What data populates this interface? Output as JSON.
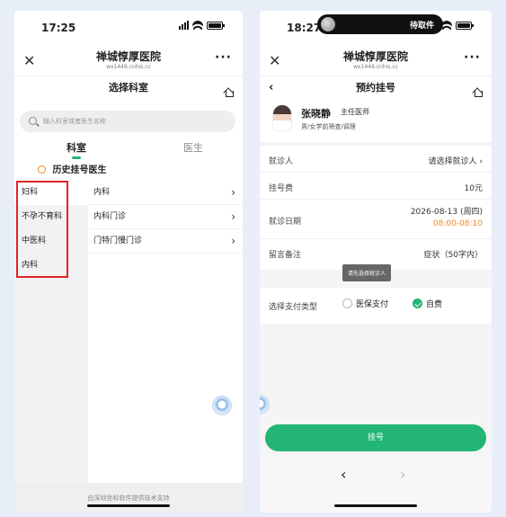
{
  "phone_left": {
    "status": {
      "time": "17:25"
    },
    "navbar": {
      "close": "✕",
      "title": "禅城惇厚医院",
      "domain": "wx1449.cnhis.cc",
      "more": "···"
    },
    "subbar": {
      "title": "选择科室"
    },
    "search": {
      "placeholder": "输入科室或者医生名称"
    },
    "tabs": {
      "dept": "科室",
      "doctor": "医生"
    },
    "history": "历史挂号医生",
    "departments": [
      "妇科",
      "不孕不育科",
      "中医科",
      "内科"
    ],
    "subdepartments": [
      "内科",
      "内科门诊",
      "门特门慢门诊"
    ],
    "chevron": "›",
    "footer": "由深圳坐标软件提供技术支持"
  },
  "phone_right": {
    "status": {
      "time": "18:27",
      "notice": "待取件"
    },
    "navbar": {
      "close": "✕",
      "title": "禅城惇厚医院",
      "domain": "wx1449.cnhis.cc",
      "more": "···"
    },
    "subbar": {
      "back": "‹",
      "title": "预约挂号"
    },
    "doctor": {
      "name": "张晓静",
      "title": "主任医师",
      "specialty": "男/女学前筛查/调理"
    },
    "form": {
      "patient_label": "就诊人",
      "patient_value": "请选择就诊人 ›",
      "fee_label": "挂号费",
      "fee_value": "10元",
      "date_label": "就诊日期",
      "date_value": "2026-08-13 (周四)",
      "time_value": "08:00-08:10",
      "remark_label": "留言备注",
      "remark_placeholder": "症状（50字内）"
    },
    "tooltip": "请先选择就诊人",
    "pay": {
      "label": "选择支付类型",
      "option1": "医保支付",
      "option2": "自费"
    },
    "button": "挂号",
    "bottom": {
      "back": "‹",
      "forward": "›"
    }
  },
  "colors": {
    "accent": "#22b573",
    "fee": "#f08a24",
    "highlight_box": "#e02424"
  }
}
